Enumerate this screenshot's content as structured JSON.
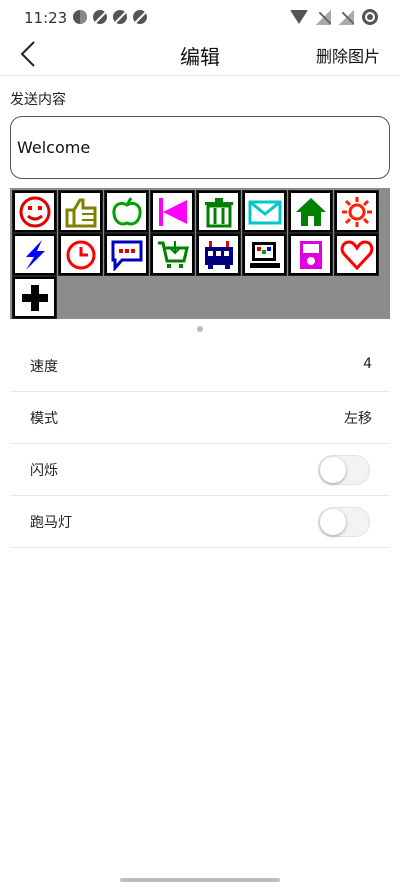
{
  "status_bar": {
    "time": "11:23",
    "left_icons": [
      "data-saver-icon",
      "notification-muted-icon",
      "notification-muted-icon",
      "notification-muted-icon"
    ],
    "right_icons": [
      "wifi-icon",
      "signal-off-icon",
      "signal-off-icon",
      "battery-ring-icon"
    ]
  },
  "header": {
    "back_icon": "back-arrow-icon",
    "title": "编辑",
    "delete_label": "删除图片"
  },
  "content": {
    "section_label": "发送内容",
    "text_value": "Welcome"
  },
  "icon_grid": {
    "icons": [
      {
        "name": "smiley-face-icon",
        "color": "#e00000"
      },
      {
        "name": "thumbs-up-icon",
        "color": "#808000"
      },
      {
        "name": "apple-icon",
        "color": "#00a000"
      },
      {
        "name": "flag-icon",
        "color": "#ff00ff"
      },
      {
        "name": "trash-can-icon",
        "color": "#008000"
      },
      {
        "name": "envelope-icon",
        "color": "#00c8c8"
      },
      {
        "name": "house-icon",
        "color": "#008000"
      },
      {
        "name": "sun-icon",
        "color": "#ff2000"
      },
      {
        "name": "lightning-icon",
        "color": "#0000ff"
      },
      {
        "name": "clock-icon",
        "color": "#ff0000"
      },
      {
        "name": "speech-bubble-icon",
        "color": "#0000c0"
      },
      {
        "name": "shopping-cart-icon",
        "color": "#008000"
      },
      {
        "name": "bus-icon",
        "color": "#000080"
      },
      {
        "name": "computer-icon",
        "color": "#000000"
      },
      {
        "name": "music-player-icon",
        "color": "#e000e0"
      },
      {
        "name": "heart-icon",
        "color": "#ff0000"
      },
      {
        "name": "add-icon",
        "color": "#000000"
      }
    ]
  },
  "settings": {
    "speed": {
      "label": "速度",
      "value": "4"
    },
    "mode": {
      "label": "模式",
      "value": "左移"
    },
    "blink": {
      "label": "闪烁",
      "enabled": false
    },
    "marquee": {
      "label": "跑马灯",
      "enabled": false
    }
  },
  "colors": {
    "panel_gray": "#8c8c8c",
    "divider": "#e8e8e8"
  }
}
